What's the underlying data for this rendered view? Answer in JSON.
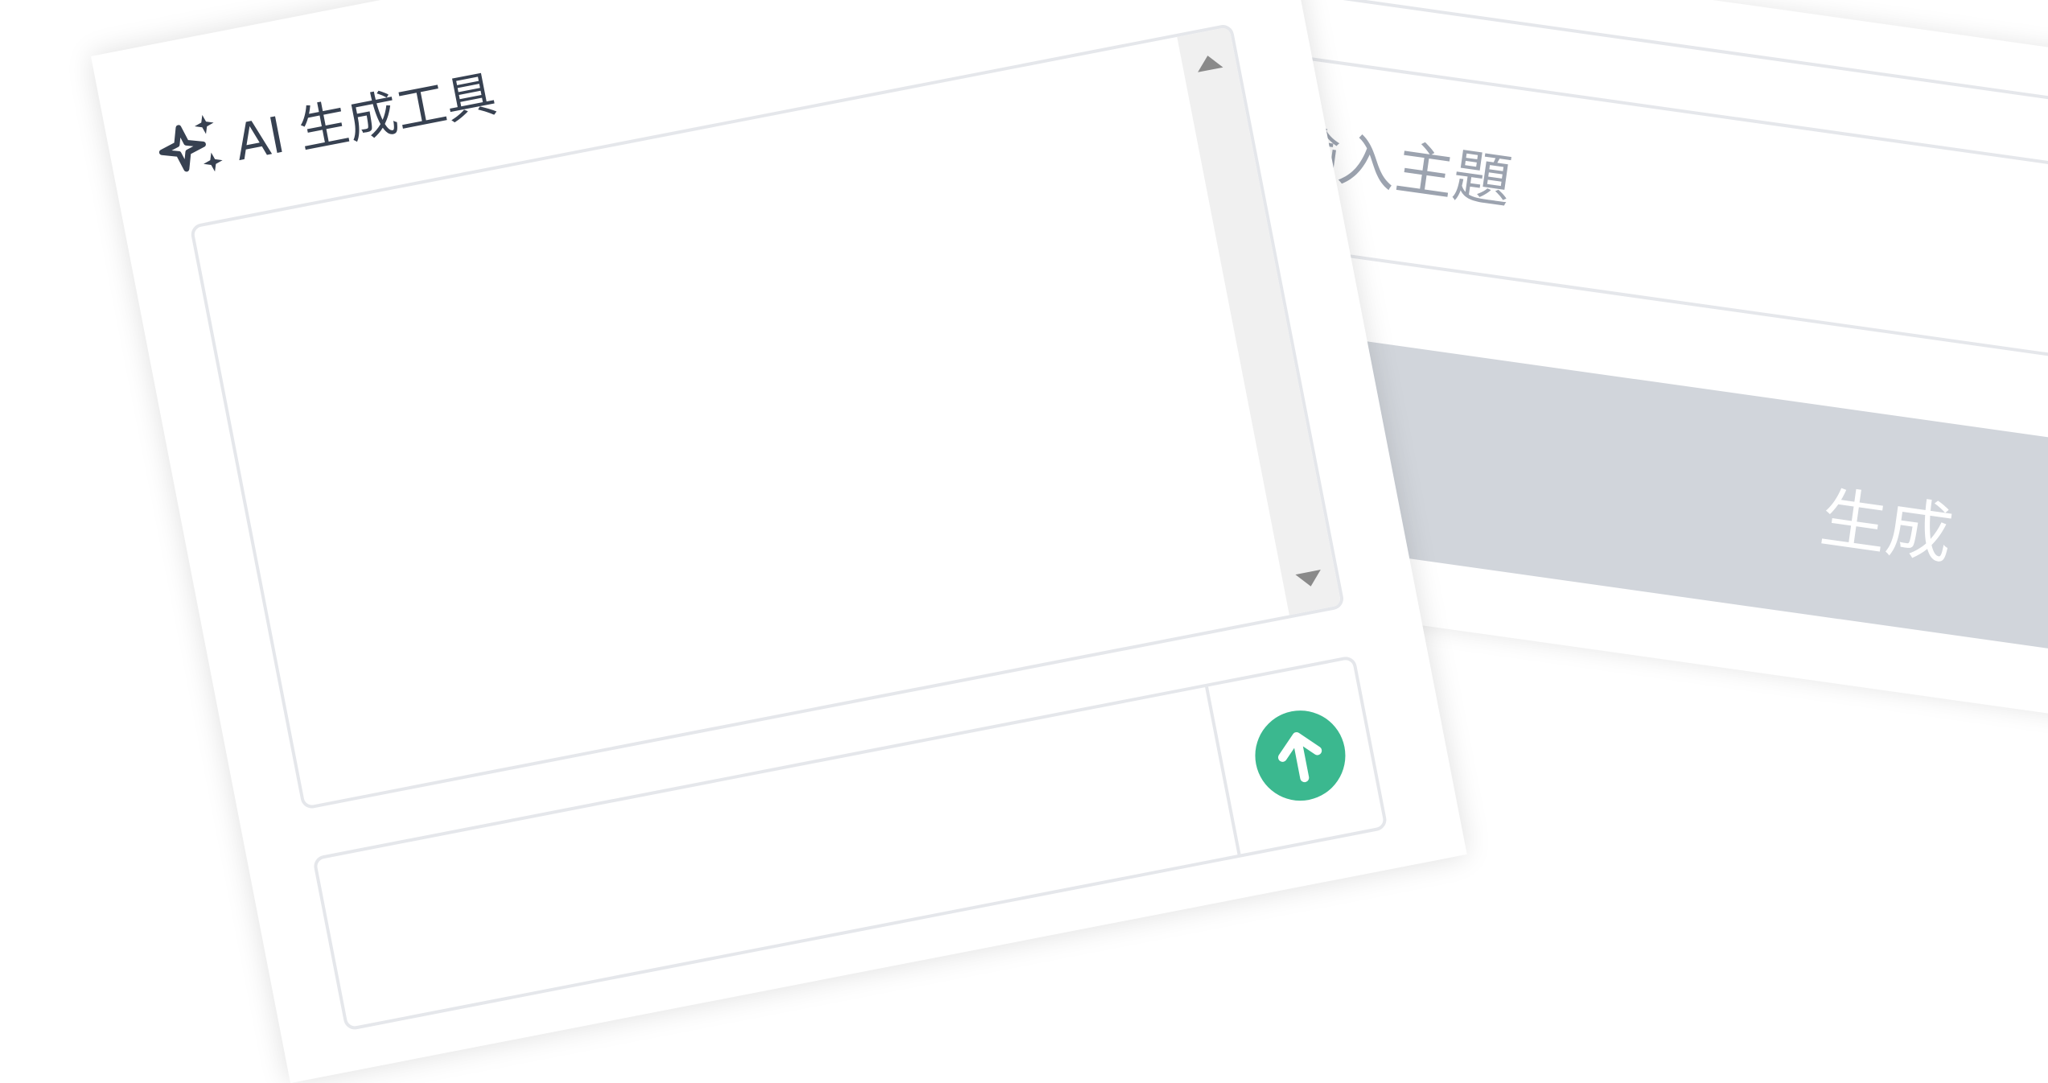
{
  "card": {
    "title": "AI 生成工具",
    "output_text": "",
    "prompt_value": ""
  },
  "topic": {
    "placeholder": "輸入主題"
  },
  "generate_button": {
    "label": "生成"
  },
  "icons": {
    "title_icon": "sparkle-icon",
    "send_icon": "arrow-up-icon",
    "scroll_up": "triangle-up-icon",
    "scroll_down": "triangle-down-icon"
  },
  "colors": {
    "send_button": "#3bb88f",
    "generate_button_bg": "#d1d5db",
    "title_text": "#374151",
    "placeholder_text": "#9ca3af"
  }
}
